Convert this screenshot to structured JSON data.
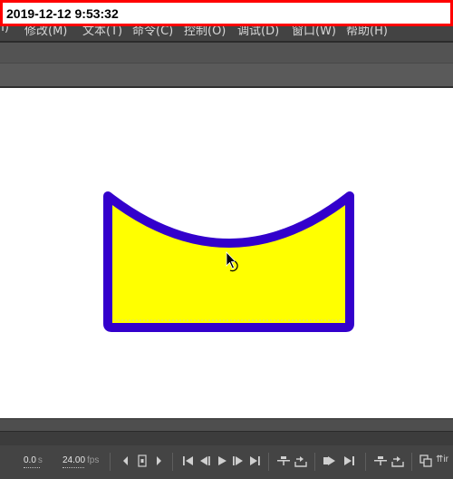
{
  "timestamp": "2019-12-12 9:53:32",
  "menu": {
    "items": [
      "(I)",
      "修改(M)",
      "文本(T)",
      "命令(C)",
      "控制(O)",
      "调试(D)",
      "窗口(W)",
      "帮助(H)"
    ]
  },
  "stage": {
    "shape": {
      "fill": "#ffff00",
      "stroke": "#3300cc"
    },
    "cursor": "rotate-cursor-icon"
  },
  "timeline": {
    "time_value": "0.0",
    "time_unit": "s",
    "fps_value": "24.00",
    "fps_unit": "fps",
    "extra_label": "⇈ir"
  },
  "colors": {
    "accent_red": "#ff0000",
    "panel_dark": "#444444",
    "stage_bg": "#ffffff"
  }
}
